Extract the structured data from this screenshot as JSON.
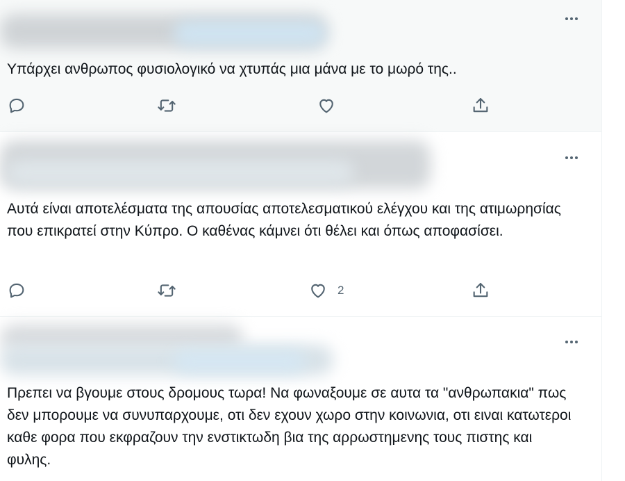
{
  "tweets": [
    {
      "text": "Υπάρχει ανθρωπος φυσιολογικό να χτυπάς μια μάνα με το μωρό της..",
      "more_icon": "more-horizontal-icon",
      "like_count": ""
    },
    {
      "text": "Αυτά είναι αποτελέσματα της απουσίας αποτελεσματικού ελέγχου και της ατιμωρησίας που επικρατεί στην Κύπρο. Ο καθένας κάμνει ότι θέλει και όπως αποφασίσει.",
      "more_icon": "more-horizontal-icon",
      "like_count": "2"
    },
    {
      "text": "Πρεπει να βγουμε στους δρομους τωρα! Να φωναξουμε σε αυτα τα \"ανθρωπακια\" πως δεν μπορουμε να συνυπαρχουμε, οτι δεν εχουν χωρο στην κοινωνια, οτι ειναι κατωτεροι καθε φορα που εκφραζουν την ενστικτωδη βια της αρρωστημενης τους πιστης και φυλης.",
      "more_icon": "more-horizontal-icon",
      "like_count": ""
    }
  ],
  "icons": {
    "reply": "reply-icon",
    "retweet": "retweet-icon",
    "like": "heart-icon",
    "share": "share-icon"
  },
  "colors": {
    "text": "#0f1419",
    "secondary": "#536471",
    "hover_bg": "#f7f9f9",
    "divider": "#eff3f4"
  }
}
